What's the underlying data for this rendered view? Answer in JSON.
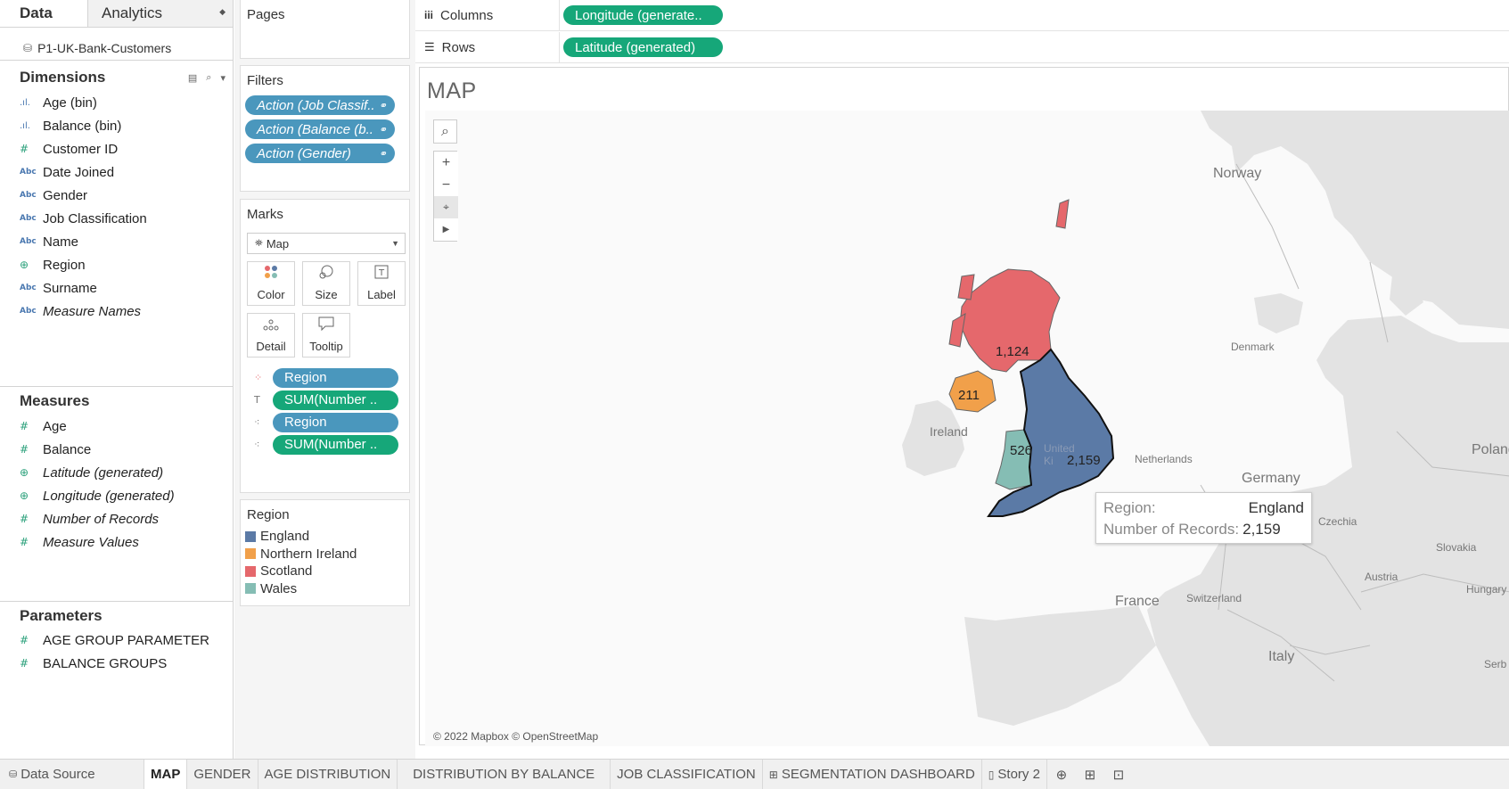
{
  "pane": {
    "data_tab": "Data",
    "analytics_tab": "Analytics",
    "datasource": "P1-UK-Bank-Customers",
    "dimensions_title": "Dimensions",
    "dimensions": [
      {
        "label": "Age (bin)",
        "icon": "bin-icon"
      },
      {
        "label": "Balance (bin)",
        "icon": "bin-icon"
      },
      {
        "label": "Customer ID",
        "icon": "number-icon"
      },
      {
        "label": "Date Joined",
        "icon": "string-icon"
      },
      {
        "label": "Gender",
        "icon": "string-icon"
      },
      {
        "label": "Job Classification",
        "icon": "string-icon"
      },
      {
        "label": "Name",
        "icon": "string-icon"
      },
      {
        "label": "Region",
        "icon": "globe-icon"
      },
      {
        "label": "Surname",
        "icon": "string-icon"
      },
      {
        "label": "Measure Names",
        "icon": "string-icon"
      }
    ],
    "measures_title": "Measures",
    "measures": [
      {
        "label": "Age",
        "icon": "number-icon"
      },
      {
        "label": "Balance",
        "icon": "number-icon"
      },
      {
        "label": "Latitude (generated)",
        "icon": "globe-icon"
      },
      {
        "label": "Longitude (generated)",
        "icon": "globe-icon"
      },
      {
        "label": "Number of Records",
        "icon": "number-icon"
      },
      {
        "label": "Measure Values",
        "icon": "number-icon"
      }
    ],
    "parameters_title": "Parameters",
    "parameters": [
      {
        "label": "AGE GROUP PARAMETER",
        "icon": "number-icon"
      },
      {
        "label": "BALANCE GROUPS",
        "icon": "number-icon"
      }
    ]
  },
  "pages_title": "Pages",
  "filters": {
    "title": "Filters",
    "items": [
      "Action (Job Classif..",
      "Action (Balance (b..",
      "Action (Gender)"
    ]
  },
  "marks": {
    "title": "Marks",
    "type": "Map",
    "buttons": [
      "Color",
      "Size",
      "Label",
      "Detail",
      "Tooltip"
    ],
    "fields": [
      {
        "label": "Region",
        "kind": "color-icon"
      },
      {
        "label": "SUM(Number ..",
        "kind": "label-icon"
      },
      {
        "label": "Region",
        "kind": "detail-icon"
      },
      {
        "label": "SUM(Number ..",
        "kind": "detail-icon"
      }
    ]
  },
  "legend": {
    "title": "Region",
    "items": [
      {
        "label": "England",
        "color": "#5b7aa6"
      },
      {
        "label": "Northern Ireland",
        "color": "#f1a04a"
      },
      {
        "label": "Scotland",
        "color": "#e5686c"
      },
      {
        "label": "Wales",
        "color": "#85bdb4"
      }
    ]
  },
  "shelves": {
    "columns_label": "Columns",
    "columns_pill": "Longitude (generate..",
    "rows_label": "Rows",
    "rows_pill": "Latitude (generated)"
  },
  "view": {
    "title": "MAP",
    "attribution": "© 2022 Mapbox © OpenStreetMap",
    "place_labels": {
      "norway": "Norway",
      "denmark": "Denmark",
      "ireland": "Ireland",
      "united_kingdom": "United Ki",
      "netherlands": "Netherlands",
      "germany": "Germany",
      "poland": "Poland",
      "czechia": "Czechia",
      "slovakia": "Slovakia",
      "austria": "Austria",
      "hungary": "Hungary",
      "switzerland": "Switzerland",
      "france": "France",
      "italy": "Italy",
      "serbia": "Serb"
    },
    "values": {
      "scotland": "1,124",
      "northern_ireland": "211",
      "wales": "526",
      "england": "2,159"
    },
    "tooltip": {
      "k1": "Region:",
      "v1": "England",
      "k2": "Number of Records:",
      "v2": "2,159"
    }
  },
  "tabs": {
    "datasource": "Data Source",
    "sheets": [
      "MAP",
      "GENDER",
      "AGE DISTRIBUTION",
      "DISTRIBUTION BY BALANCE",
      "JOB CLASSIFICATION",
      "SEGMENTATION DASHBOARD",
      "Story 2"
    ]
  }
}
